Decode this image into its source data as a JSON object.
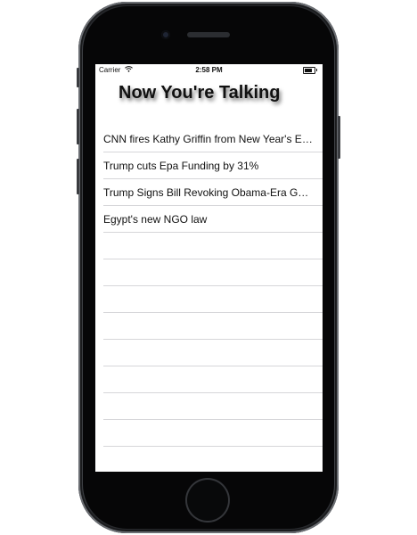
{
  "status_bar": {
    "carrier": "Carrier",
    "wifi_icon": "wifi-icon",
    "time": "2:58 PM",
    "battery_level": 0.85
  },
  "app": {
    "title": "Now You're Talking"
  },
  "news_list": {
    "items": [
      {
        "label": "CNN fires Kathy Griffin from New Year's Ev..."
      },
      {
        "label": "Trump cuts Epa Funding by 31%"
      },
      {
        "label": "Trump Signs Bill Revoking Obama-Era Gun..."
      },
      {
        "label": "Egypt's new NGO law"
      },
      {
        "label": ""
      },
      {
        "label": ""
      },
      {
        "label": ""
      },
      {
        "label": ""
      },
      {
        "label": ""
      },
      {
        "label": ""
      },
      {
        "label": ""
      },
      {
        "label": ""
      }
    ]
  }
}
